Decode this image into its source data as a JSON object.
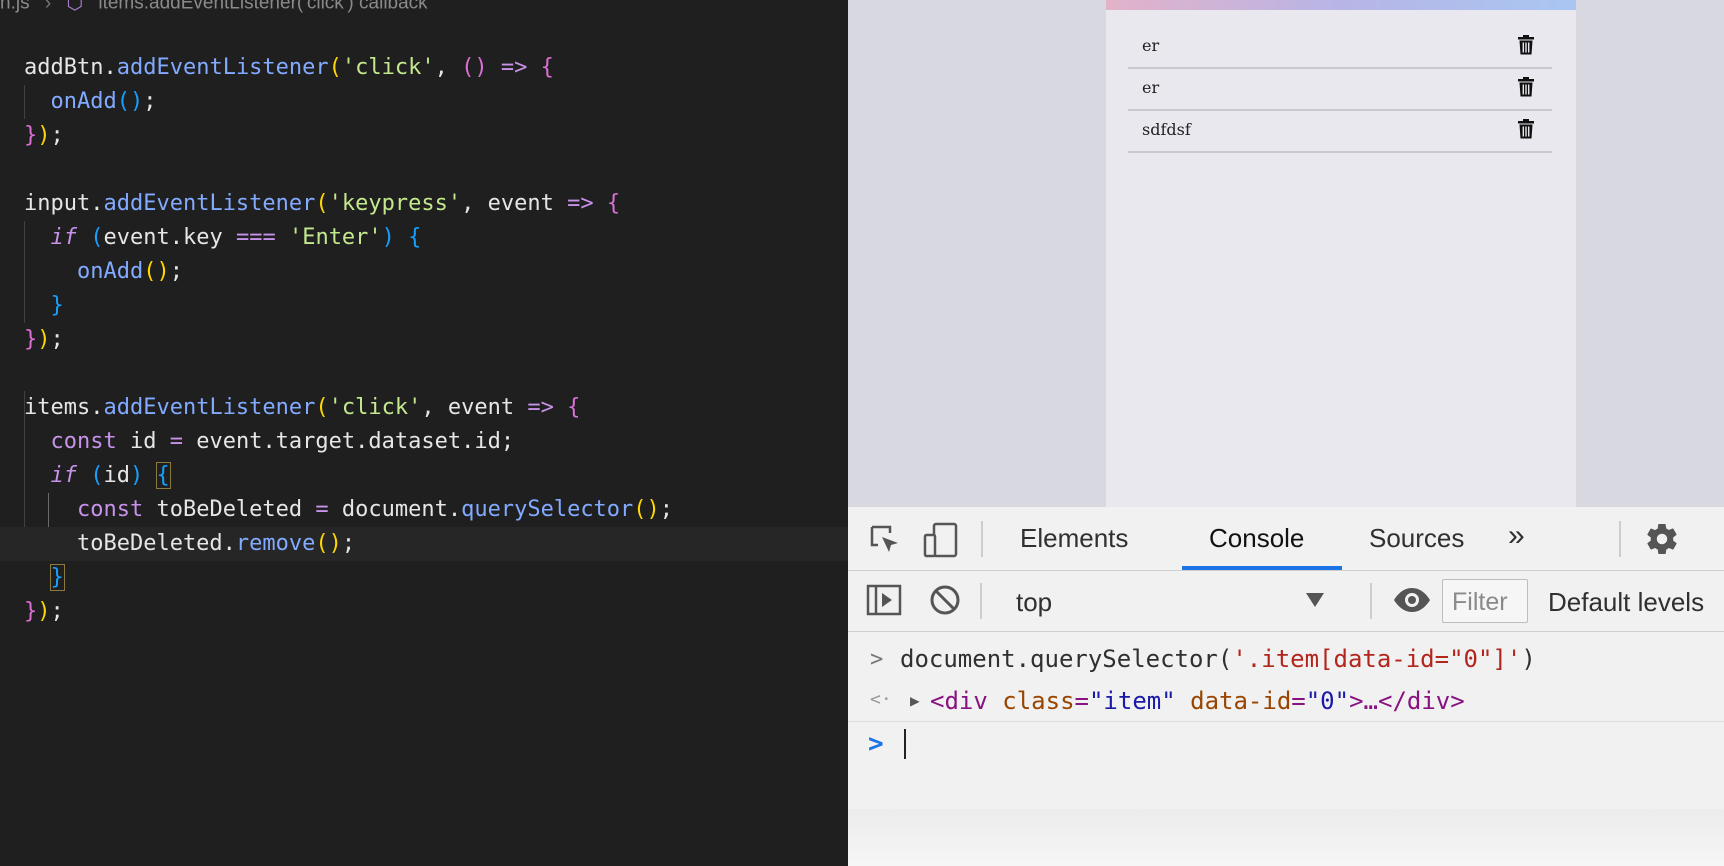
{
  "editor": {
    "breadcrumb": {
      "file": "n.js",
      "symbol": "items.addEventListener('click') callback"
    },
    "lines": [
      [
        {
          "c": "t-var",
          "t": "addBtn"
        },
        {
          "c": "t-punc",
          "t": "."
        },
        {
          "c": "t-fn",
          "t": "addEventListener"
        },
        {
          "c": "t-p1",
          "t": "("
        },
        {
          "c": "t-str",
          "t": "'click'"
        },
        {
          "c": "t-punc",
          "t": ", "
        },
        {
          "c": "t-p2",
          "t": "()"
        },
        {
          "c": "t-punc",
          "t": " "
        },
        {
          "c": "t-op",
          "t": "=>"
        },
        {
          "c": "t-punc",
          "t": " "
        },
        {
          "c": "t-p2",
          "t": "{"
        }
      ],
      [
        {
          "c": "t-punc",
          "t": "  "
        },
        {
          "c": "t-fn",
          "t": "onAdd"
        },
        {
          "c": "t-p3",
          "t": "()"
        },
        {
          "c": "t-punc",
          "t": ";"
        }
      ],
      [
        {
          "c": "t-p2",
          "t": "}"
        },
        {
          "c": "t-p1",
          "t": ")"
        },
        {
          "c": "t-punc",
          "t": ";"
        }
      ],
      [],
      [
        {
          "c": "t-var",
          "t": "input"
        },
        {
          "c": "t-punc",
          "t": "."
        },
        {
          "c": "t-fn",
          "t": "addEventListener"
        },
        {
          "c": "t-p1",
          "t": "("
        },
        {
          "c": "t-str",
          "t": "'keypress'"
        },
        {
          "c": "t-punc",
          "t": ", event "
        },
        {
          "c": "t-op",
          "t": "=>"
        },
        {
          "c": "t-punc",
          "t": " "
        },
        {
          "c": "t-p2",
          "t": "{"
        }
      ],
      [
        {
          "c": "t-punc",
          "t": "  "
        },
        {
          "c": "t-kwi",
          "t": "if"
        },
        {
          "c": "t-punc",
          "t": " "
        },
        {
          "c": "t-p3",
          "t": "("
        },
        {
          "c": "t-var",
          "t": "event.key "
        },
        {
          "c": "t-op",
          "t": "==="
        },
        {
          "c": "t-punc",
          "t": " "
        },
        {
          "c": "t-str",
          "t": "'Enter'"
        },
        {
          "c": "t-p3",
          "t": ")"
        },
        {
          "c": "t-punc",
          "t": " "
        },
        {
          "c": "t-p3",
          "t": "{"
        }
      ],
      [
        {
          "c": "t-punc",
          "t": "    "
        },
        {
          "c": "t-fn",
          "t": "onAdd"
        },
        {
          "c": "t-p1",
          "t": "()"
        },
        {
          "c": "t-punc",
          "t": ";"
        }
      ],
      [
        {
          "c": "t-punc",
          "t": "  "
        },
        {
          "c": "t-p3",
          "t": "}"
        }
      ],
      [
        {
          "c": "t-p2",
          "t": "}"
        },
        {
          "c": "t-p1",
          "t": ")"
        },
        {
          "c": "t-punc",
          "t": ";"
        }
      ],
      [],
      [
        {
          "c": "t-var",
          "t": "items"
        },
        {
          "c": "t-punc",
          "t": "."
        },
        {
          "c": "t-fn",
          "t": "addEventListener"
        },
        {
          "c": "t-p1",
          "t": "("
        },
        {
          "c": "t-str",
          "t": "'click'"
        },
        {
          "c": "t-punc",
          "t": ", event "
        },
        {
          "c": "t-op",
          "t": "=>"
        },
        {
          "c": "t-punc",
          "t": " "
        },
        {
          "c": "t-p2",
          "t": "{"
        }
      ],
      [
        {
          "c": "t-punc",
          "t": "  "
        },
        {
          "c": "t-kw",
          "t": "const"
        },
        {
          "c": "t-punc",
          "t": " id "
        },
        {
          "c": "t-op",
          "t": "="
        },
        {
          "c": "t-punc",
          "t": " event.target.dataset.id;"
        }
      ],
      [
        {
          "c": "t-punc",
          "t": "  "
        },
        {
          "c": "t-kwi",
          "t": "if"
        },
        {
          "c": "t-punc",
          "t": " "
        },
        {
          "c": "t-p3",
          "t": "("
        },
        {
          "c": "t-var",
          "t": "id"
        },
        {
          "c": "t-p3",
          "t": ")"
        },
        {
          "c": "t-punc",
          "t": " "
        },
        {
          "c": "t-p3 bracket-box",
          "t": "{"
        }
      ],
      [
        {
          "c": "t-punc",
          "t": "    "
        },
        {
          "c": "t-kw",
          "t": "const"
        },
        {
          "c": "t-punc",
          "t": " toBeDeleted "
        },
        {
          "c": "t-op",
          "t": "="
        },
        {
          "c": "t-punc",
          "t": " document."
        },
        {
          "c": "t-fn",
          "t": "querySelector"
        },
        {
          "c": "t-p1",
          "t": "()"
        },
        {
          "c": "t-punc",
          "t": ";"
        }
      ],
      [
        {
          "c": "t-punc",
          "t": "    toBeDeleted."
        },
        {
          "c": "t-fn",
          "t": "remove"
        },
        {
          "c": "t-p1",
          "t": "()"
        },
        {
          "c": "t-punc",
          "t": ";"
        }
      ],
      [
        {
          "c": "t-punc",
          "t": "  "
        },
        {
          "c": "t-p3 bracket-box",
          "t": "}"
        }
      ],
      [
        {
          "c": "t-p2",
          "t": "}"
        },
        {
          "c": "t-p1",
          "t": ")"
        },
        {
          "c": "t-punc",
          "t": ";"
        }
      ]
    ],
    "current_line": 14
  },
  "preview": {
    "items": [
      "er",
      "er",
      "sdfdsf"
    ]
  },
  "devtools": {
    "tabs": [
      "Elements",
      "Console",
      "Sources"
    ],
    "active_tab": "Console",
    "more_tabs": "»",
    "context": "top",
    "filter_placeholder": "Filter",
    "levels": "Default levels",
    "console": {
      "input_prompt": ">",
      "input_prefix": "document.querySelector(",
      "input_arg": "'.item[data-id=\"0\"]'",
      "input_suffix": ")",
      "result_prompt": "<·",
      "result": {
        "open": "<",
        "tag": "div",
        "attr1": "class",
        "val1": "\"item\"",
        "attr2": "data-id",
        "val2": "\"0\"",
        "ellipsis": ">…</",
        "close_tag": "div",
        "end": ">"
      },
      "active_prompt": ">"
    },
    "accent": "#1a73e8"
  }
}
